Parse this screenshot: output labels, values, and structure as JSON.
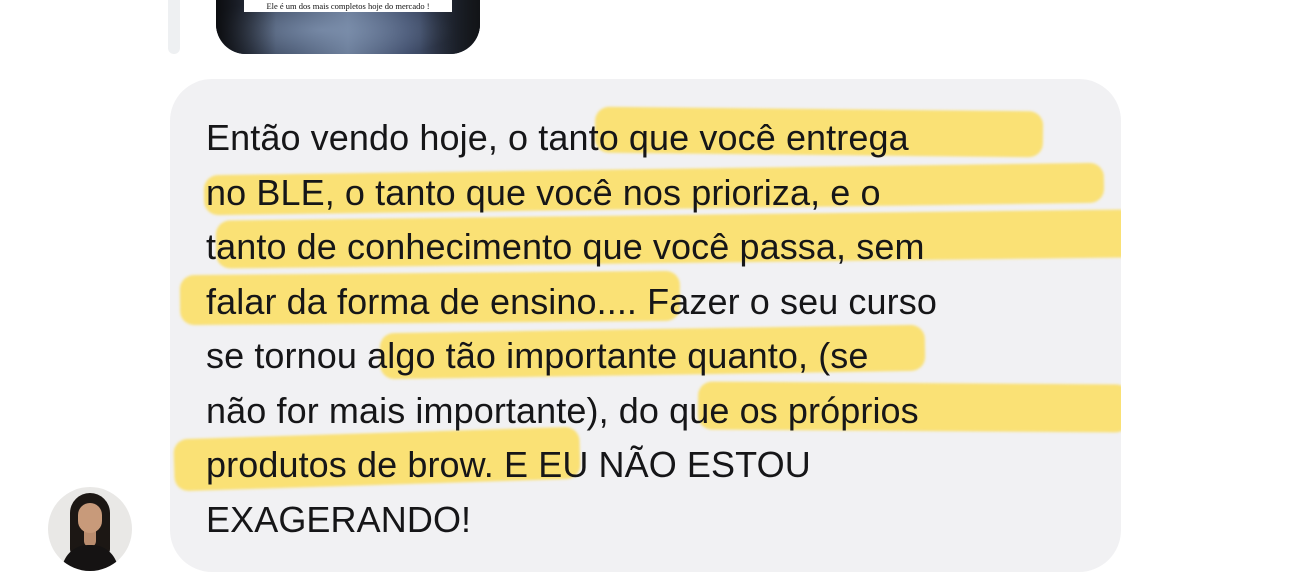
{
  "media": {
    "caption": "Ele é um dos mais completos hoje do mercado !",
    "image_icon": "media-thumbnail-image"
  },
  "message": {
    "text": "Então vendo hoje, o tanto que você entrega\nno BLE, o tanto que você nos prioriza, e o\ntanto de conhecimento que você passa, sem\nfalar da forma de ensino.... Fazer o seu curso\nse tornou algo tão importante quanto, (se\nnão for mais importante), do que os próprios\nprodutos de brow. E EU NÃO ESTOU\nEXAGERANDO!",
    "highlight_color": "#ffd628",
    "bubble_color": "#f1f1f3"
  },
  "sender": {
    "avatar_icon": "avatar-icon"
  }
}
